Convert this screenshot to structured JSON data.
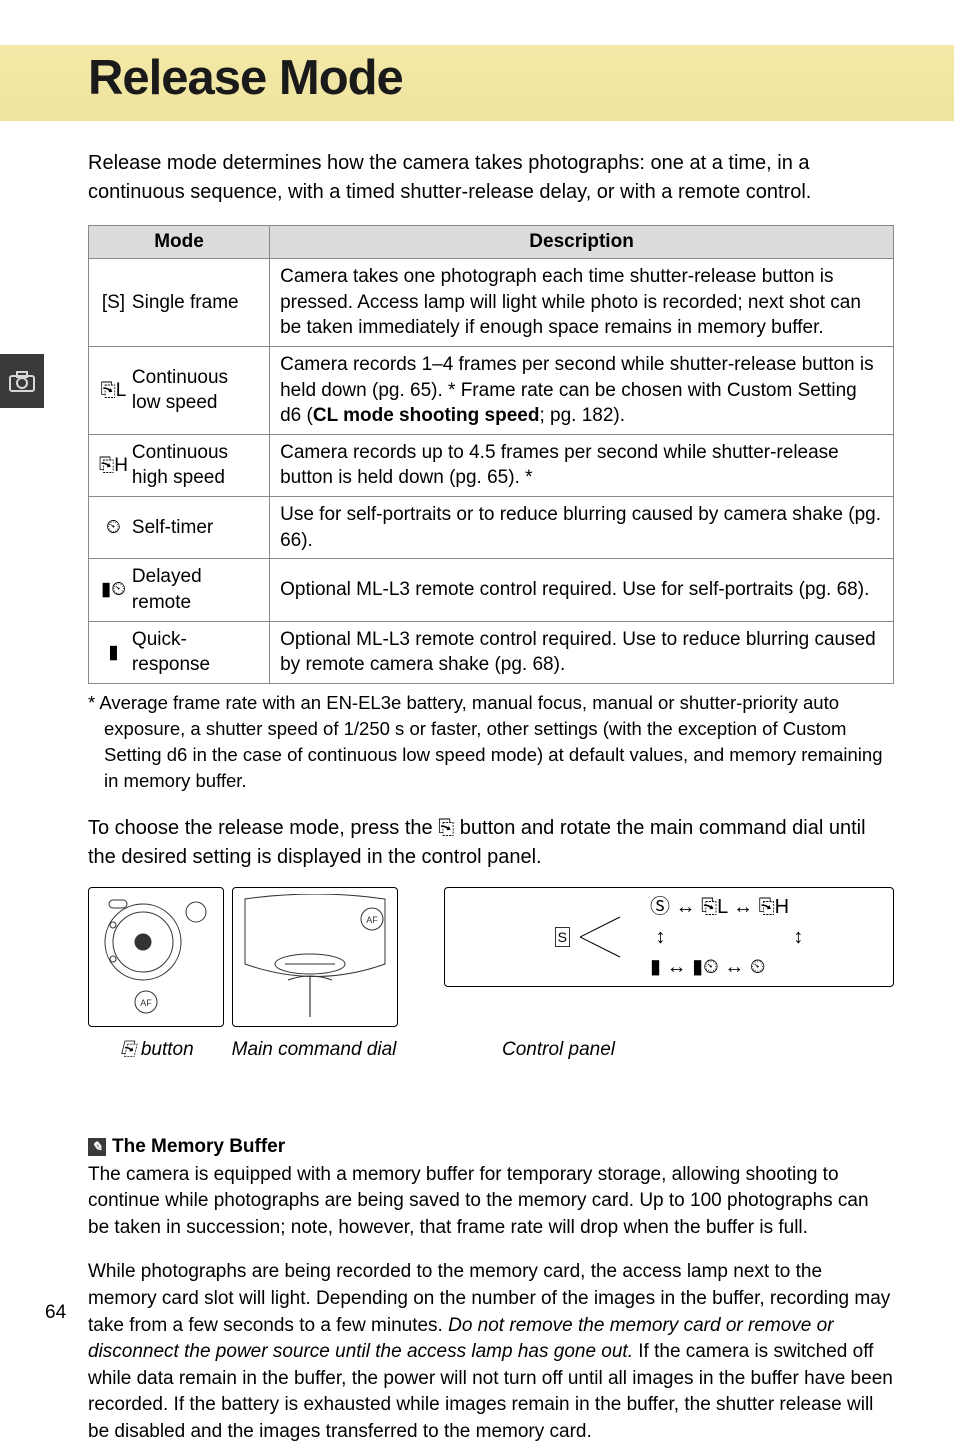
{
  "title": "Release Mode",
  "intro": "Release mode determines how the camera takes photographs: one at a time, in a continuous sequence, with a timed shutter-release delay, or with a remote control.",
  "table": {
    "headers": {
      "mode": "Mode",
      "description": "Description"
    },
    "rows": [
      {
        "icon": "[S]",
        "label": "Single frame",
        "desc": "Camera takes one photograph each time shutter-release button is pressed. Access lamp will light while photo is recorded; next shot can be taken immediately if enough space remains in memory buffer."
      },
      {
        "icon": "⎘L",
        "label": "Continuous low speed",
        "desc_pre": "Camera records 1–4 frames per second while shutter-release button is held down (pg. 65). * Frame rate can be chosen with Custom Setting d6 (",
        "desc_bold": "CL mode shooting speed",
        "desc_post": "; pg. 182)."
      },
      {
        "icon": "⎘H",
        "label": "Continuous high speed",
        "desc": "Camera records up to 4.5 frames per second while shutter-release button is held down (pg. 65). *"
      },
      {
        "icon": "⏲",
        "label": "Self-timer",
        "desc": "Use for self-portraits or to reduce blurring caused by camera shake (pg. 66)."
      },
      {
        "icon": "▮⏲",
        "label": "Delayed remote",
        "desc": "Optional ML-L3 remote control required.  Use for self-portraits (pg. 68)."
      },
      {
        "icon": "▮",
        "label": "Quick-response",
        "desc": "Optional ML-L3 remote control required.  Use to reduce blurring caused by remote camera shake (pg. 68)."
      }
    ]
  },
  "footnote": "*  Average frame rate with an EN-EL3e battery, manual focus, manual or shutter-priority auto exposure, a shutter speed of 1/250 s or faster, other settings (with the exception of Custom Setting d6 in the case of continuous low speed mode) at default values, and memory remaining in memory buffer.",
  "choose_text": "To choose the release mode, press the ⎘ button and rotate the main command dial until the desired setting is displayed in the control panel.",
  "captions": {
    "button": "⎘ button",
    "dial": "Main command dial",
    "panel": "Control panel"
  },
  "info": {
    "header": "The Memory Buffer",
    "p1": "The camera is equipped with a memory buffer for temporary storage, allowing shooting to continue while photographs are being saved to the memory card.   Up to 100 photographs can be taken in succession; note, however, that frame rate will drop when the buffer is full.",
    "p2_pre": "While photographs are being recorded to the memory card, the access lamp next to the memory card slot will light.   Depending on the number of the images in the buffer, recording may take from a few seconds to a few minutes.   ",
    "p2_italic": "Do not remove the memory card or remove or disconnect the power source until the access lamp has gone out.",
    "p2_post": "   If the camera is switched off while data remain in the buffer, the power will not turn off until all images in the buffer have been recorded.  If the battery is exhausted while images remain in the buffer, the shutter release will be disabled and the images transferred to the memory card."
  },
  "page_number": "64",
  "cycle": {
    "line1": "Ⓢ ↔ ⎘L ↔ ⎘H",
    "line2": "▮   ↔  ▮⏲  ↔   ⏲"
  }
}
